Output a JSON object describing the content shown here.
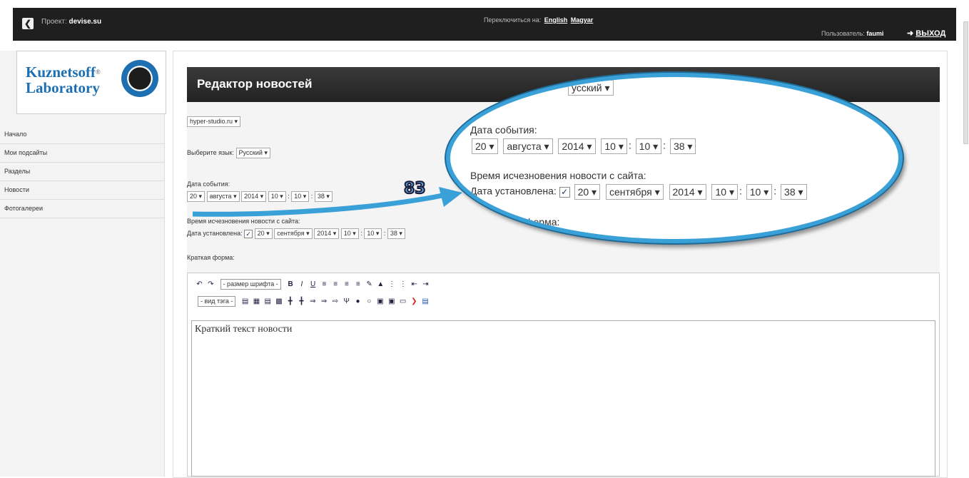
{
  "topbar": {
    "project_label": "Проект:",
    "project_name": "devise.su",
    "switch_label": "Переключиться на:",
    "lang1": "English",
    "lang2": "Magyar",
    "users_label": "Пользователь:",
    "user_name": "faumi",
    "exit_label": "ВЫХОД"
  },
  "logo": {
    "line1": "Kuznetsoff",
    "line2": "Laboratory"
  },
  "sidebar": {
    "items": [
      {
        "label": "Начало"
      },
      {
        "label": "Мои подсайты"
      },
      {
        "label": "Разделы"
      },
      {
        "label": "Новости"
      },
      {
        "label": "Фотогалереи"
      }
    ]
  },
  "editor": {
    "title": "Редактор новостей",
    "site_select": "hyper-studio.ru",
    "lang_label": "Выберите язык:",
    "lang_value": "Русский",
    "event_date_label": "Дата события:",
    "event_date": {
      "day": "20",
      "month": "августа",
      "year": "2014",
      "hour": "10",
      "min": "10",
      "sec": "38"
    },
    "expire_label": "Время исчезновения новости с сайта:",
    "date_set_label": "Дата установлена:",
    "expire_date": {
      "day": "20",
      "month": "сентября",
      "year": "2014",
      "hour": "10",
      "min": "10",
      "sec": "38"
    },
    "short_form_label": "Краткая форма:",
    "font_size_select": "- размер шрифта -",
    "tag_select": "- вид тэга -",
    "body_text": "Краткий текст новости"
  },
  "callout": {
    "top_lang": "усский",
    "event_date_label": "Дата события:",
    "expire_label": "Время исчезновения новости с сайта:",
    "date_set_label": "Дата установлена:",
    "short_form_fragment": "форма:"
  },
  "annotation": {
    "step": "83",
    "arrow_color": "#3aa0d8"
  }
}
